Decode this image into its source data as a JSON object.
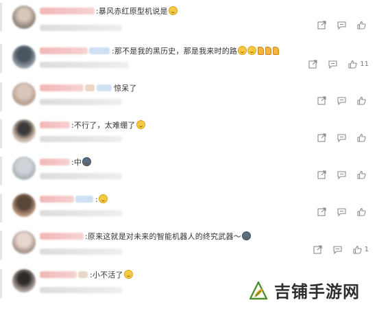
{
  "comments": [
    {
      "text": "暴风赤红原型机说是",
      "likes": ""
    },
    {
      "text": "那不是我的黑历史，那是我来时的路",
      "likes": "11"
    },
    {
      "text": "惊呆了",
      "likes": ""
    },
    {
      "text": "不行了，太难绷了",
      "likes": ""
    },
    {
      "text": "中",
      "likes": ""
    },
    {
      "text": "",
      "likes": ""
    },
    {
      "text": "原来这就是对未来的智能机器人的终究武器～",
      "likes": "1"
    },
    {
      "text": "小不活了",
      "likes": ""
    }
  ],
  "watermark": {
    "brand": "吉铺手游网"
  },
  "icons": {
    "share": "share-icon",
    "reply": "comment-icon",
    "like": "thumbs-up-icon"
  }
}
